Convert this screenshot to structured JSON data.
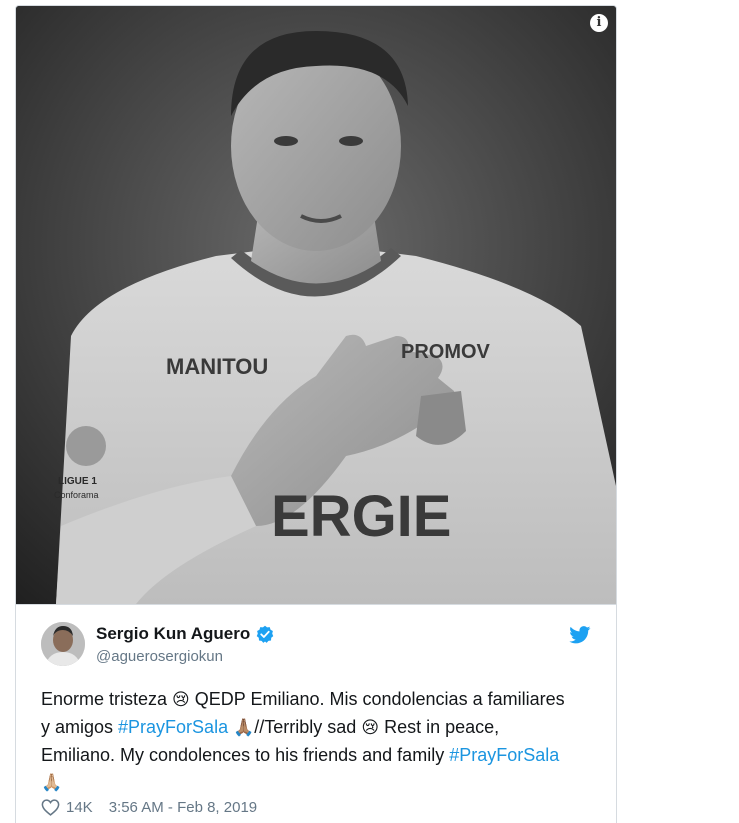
{
  "media": {
    "info_icon": "info-icon",
    "jersey_text": [
      "MANITOU",
      "ERGIE",
      "LIGUE 1",
      "Conforama",
      "PROMOV"
    ]
  },
  "author": {
    "display_name": "Sergio Kun Aguero",
    "handle": "@aguerosergiokun",
    "verified": true,
    "avatar": "avatar-image"
  },
  "tweet": {
    "line1_a": "Enorme tristeza ",
    "emoji_cry": "😢",
    "line1_b": " QEDP Emiliano. Mis condolencias a familiares y amigos ",
    "hashtag": "#PrayForSala",
    "emoji_pray_dark": "🙏🏽",
    "line2_a": "//Terribly sad ",
    "line2_b": " Rest in peace, Emiliano. My condolences to his friends and family ",
    "emoji_pray_light": "🙏🏼"
  },
  "footer": {
    "likes": "14K",
    "timestamp": "3:56 AM - Feb 8, 2019"
  },
  "colors": {
    "link": "#1b95e0",
    "muted": "#657786",
    "verified": "#1da1f2",
    "twitter": "#1da1f2"
  }
}
